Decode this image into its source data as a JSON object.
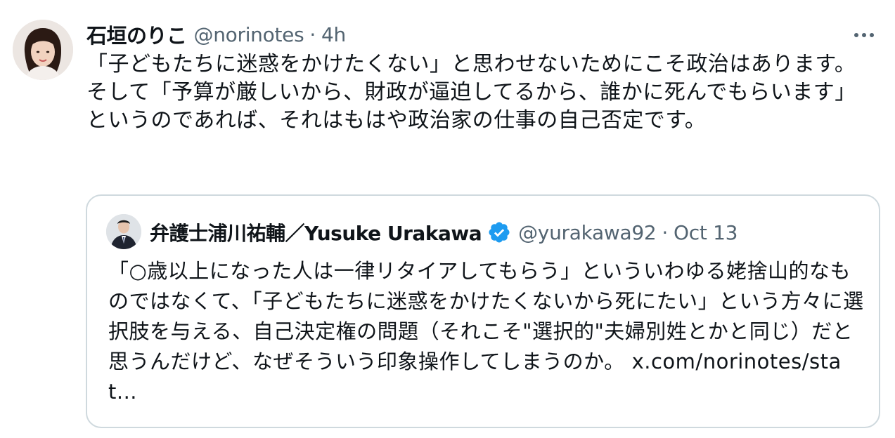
{
  "tweet": {
    "author_name": "石垣のりこ",
    "handle": "@norinotes",
    "separator": "·",
    "time": "4h",
    "text": "「子どもたちに迷惑をかけたくない」と思わせないためにこそ政治はあります。\nそして「予算が厳しいから、財政が逼迫してるから、誰かに死んでもらいます」というのであれば、それはもはや政治家の仕事の自己否定です。",
    "more_icon": "more-horizontal-icon"
  },
  "quoted_tweet": {
    "author_name": "弁護士浦川祐輔／Yusuke Urakawa",
    "verified_icon": "verified-badge-icon",
    "handle": "@yurakawa92",
    "separator": "·",
    "date": "Oct 13",
    "text": "「○歳以上になった人は一律リタイアしてもらう」といういわゆる姥捨山的なものではなくて、「子どもたちに迷惑をかけたくないから死にたい」という方々に選択肢を与える、自己決定権の問題（それこそ\"選択的\"夫婦別姓とかと同じ）だと思うんだけど、なぜそういう印象操作してしまうのか。",
    "link": "x.com/norinotes/stat..."
  },
  "colors": {
    "text_primary": "#0f1419",
    "text_secondary": "#536471",
    "border": "#cfd9de",
    "verified": "#1d9bf0"
  }
}
